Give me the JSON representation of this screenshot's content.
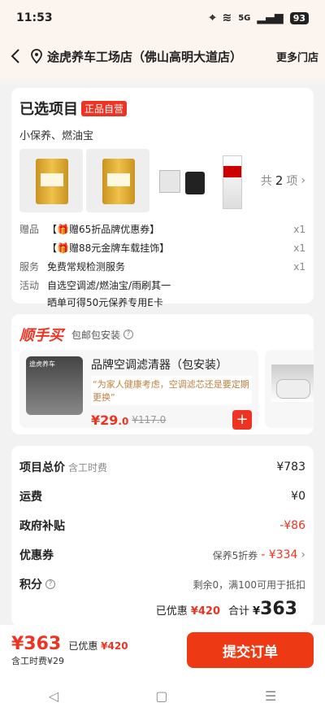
{
  "status": {
    "time": "11:53",
    "battery": "93",
    "signal": "5G"
  },
  "nav": {
    "shop_name": "途虎养车工场店（佛山高明大道店）",
    "more": "更多门店"
  },
  "selected": {
    "title": "已选项目",
    "badge": "正品自营",
    "subtitle": "小保养、燃油宝",
    "count_prefix": "共",
    "count": "2",
    "count_suffix": "项",
    "gift_label": "赠品",
    "gifts": [
      {
        "text": "【🎁赠65折品牌优惠券】",
        "qty": "x1"
      },
      {
        "text": "【🎁赠88元金牌车载挂饰】",
        "qty": "x1"
      }
    ],
    "service_label": "服务",
    "service": "免费常规检测服务",
    "service_qty": "x1",
    "activity_label": "活动",
    "activity1": "自选空调滤/燃油宝/雨刷其一",
    "activity2": "晒单可得50元保养专用E卡"
  },
  "addon": {
    "title": "顺手买",
    "sub": "包邮包安装",
    "product": {
      "image_text": "途虎养车",
      "name": "品牌空调滤清器（包安装）",
      "desc": "“为家人健康考虑，空调滤芯还是要定期更换”",
      "price": "¥29",
      "price_dec": ".0",
      "old_price": "¥117.0",
      "add": "+"
    }
  },
  "summary": {
    "total_label": "项目总价",
    "total_note": "含工时费",
    "total_value": "¥783",
    "shipping_label": "运费",
    "shipping_value": "¥0",
    "subsidy_label": "政府补贴",
    "subsidy_value": "-¥86",
    "coupon_label": "优惠券",
    "coupon_desc": "保养5折券",
    "coupon_value": "- ¥334",
    "points_label": "积分",
    "points_note": "剩余0，满100可用于抵扣",
    "discount_label": "已优惠",
    "discount_value": "¥420",
    "sum_label": "合计",
    "sum_currency": "¥",
    "sum_value": "363"
  },
  "bottom": {
    "price": "¥363",
    "disc_label": "已优惠",
    "disc_value": "¥420",
    "sub": "含工时费¥29",
    "submit": "提交订单"
  },
  "colors": {
    "accent": "#ee3322",
    "background": "#f2f2f2"
  }
}
